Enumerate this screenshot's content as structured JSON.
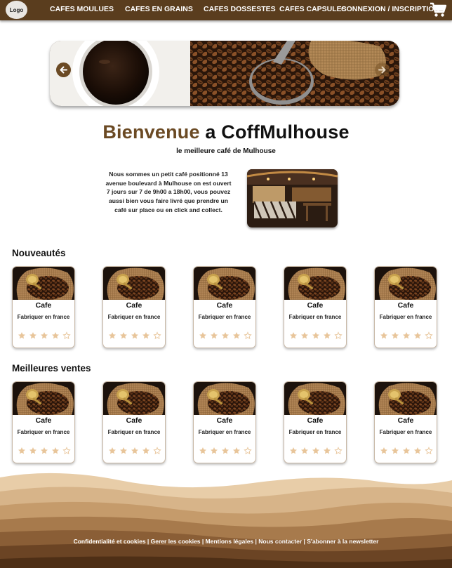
{
  "nav": {
    "logo": "Logo",
    "links": [
      "CAFES MOULUES",
      "CAFES EN GRAINS",
      "CAFES DOSSESTES",
      "CAFES CAPSULES",
      "CONNEXION / INSCRIPTION"
    ]
  },
  "welcome": {
    "part1": "Bienvenue",
    "part2": "a CoffMulhouse",
    "subtitle": "le meilleure café de Mulhouse"
  },
  "intro": "Nous sommes un petit café positionné 13 avenue boulevard à Mulhouse on est ouvert 7 jours sur 7 de 9h00 a 18h00, vous pouvez aussi bien vous faire livré que prendre un café sur place ou en click and collect.",
  "sections": {
    "new": {
      "title": "Nouveautés",
      "products": [
        {
          "name": "Cafe",
          "origin": "Fabriquer en france",
          "rating": 4
        },
        {
          "name": "Cafe",
          "origin": "Fabriquer en france",
          "rating": 4
        },
        {
          "name": "Cafe",
          "origin": "Fabriquer en france",
          "rating": 4
        },
        {
          "name": "Cafe",
          "origin": "Fabriquer en france",
          "rating": 4
        },
        {
          "name": "Cafe",
          "origin": "Fabriquer en france",
          "rating": 4
        }
      ]
    },
    "best": {
      "title": "Meilleures ventes",
      "products": [
        {
          "name": "Cafe",
          "origin": "Fabriquer en france",
          "rating": 4
        },
        {
          "name": "Cafe",
          "origin": "Fabriquer en france",
          "rating": 4
        },
        {
          "name": "Cafe",
          "origin": "Fabriquer en france",
          "rating": 4
        },
        {
          "name": "Cafe",
          "origin": "Fabriquer en france",
          "rating": 4
        },
        {
          "name": "Cafe",
          "origin": "Fabriquer en france",
          "rating": 4
        }
      ]
    }
  },
  "footer": {
    "links": [
      "Confidentialité et cookies",
      "Gerer les cookies",
      "Mentions légales",
      "Nous contacter",
      "S'abonner à la newsletter"
    ],
    "separator": " | "
  },
  "colors": {
    "brand_brown": "#5a3d1e",
    "accent_brown": "#6b4a24",
    "star_filled": "#e8c59a",
    "star_empty": "#e8c59a"
  },
  "icons": {
    "cart": "cart-icon",
    "prev": "arrow-left-icon",
    "next": "arrow-right-icon",
    "star": "star-icon"
  }
}
